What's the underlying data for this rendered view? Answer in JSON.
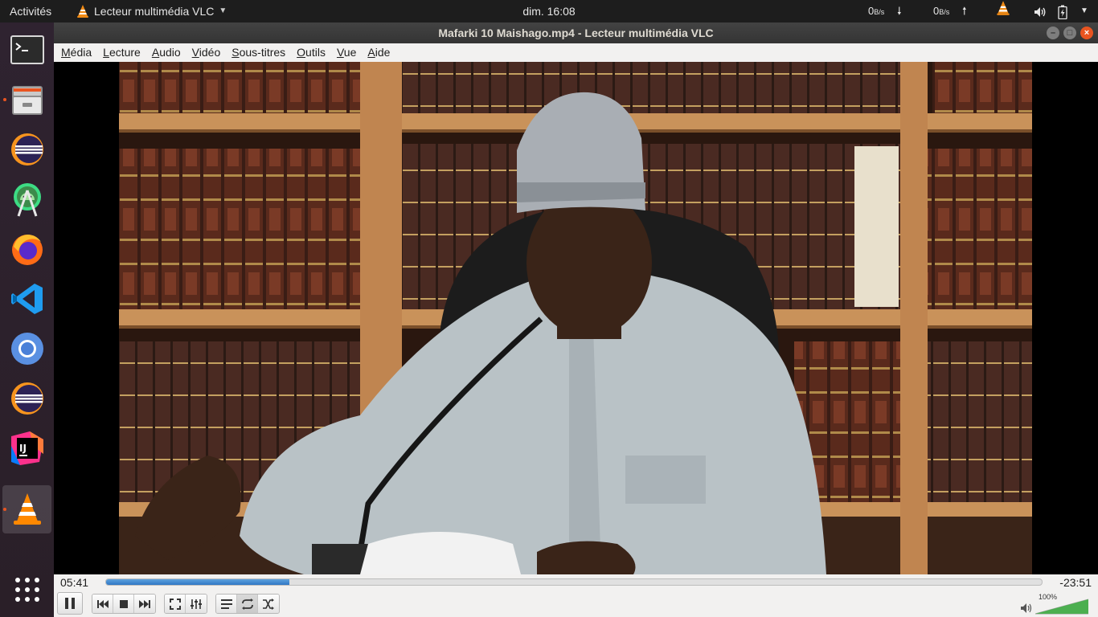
{
  "topbar": {
    "activities": "Activités",
    "app_menu": "Lecteur multimédia VLC",
    "clock": "dim. 16:08",
    "net_down_value": "0",
    "net_down_unit": "B/s",
    "net_up_value": "0",
    "net_up_unit": "B/s",
    "accent": "#e95420"
  },
  "dock": {
    "items": [
      {
        "name": "terminal",
        "icon": "terminal-icon",
        "running": false
      },
      {
        "name": "files",
        "icon": "file-cabinet-icon",
        "running": true
      },
      {
        "name": "eclipse",
        "icon": "eclipse-icon",
        "running": false
      },
      {
        "name": "android-studio",
        "icon": "android-studio-icon",
        "running": false
      },
      {
        "name": "firefox",
        "icon": "firefox-icon",
        "running": false
      },
      {
        "name": "vscode",
        "icon": "vscode-icon",
        "running": false
      },
      {
        "name": "chromium",
        "icon": "chromium-icon",
        "running": false
      },
      {
        "name": "eclipse-2",
        "icon": "eclipse-icon",
        "running": false
      },
      {
        "name": "intellij",
        "icon": "intellij-icon",
        "running": false
      },
      {
        "name": "vlc",
        "icon": "vlc-icon",
        "running": true,
        "active": true
      }
    ],
    "show_apps": "grid-icon"
  },
  "window": {
    "title": "Mafarki 10 Maishago.mp4 - Lecteur multimédia VLC"
  },
  "menubar": [
    "Média",
    "Lecture",
    "Audio",
    "Vidéo",
    "Sous-titres",
    "Outils",
    "Vue",
    "Aide"
  ],
  "player": {
    "elapsed": "05:41",
    "remaining": "-23:51",
    "progress": 0.196,
    "volume_label": "100%",
    "volume": 1.0
  }
}
